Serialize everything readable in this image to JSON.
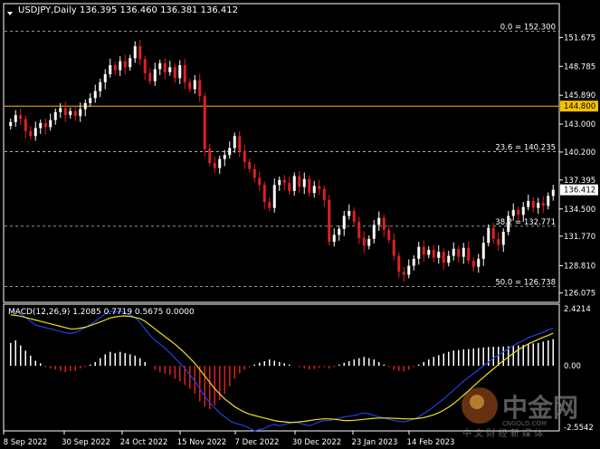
{
  "header": {
    "symbol": "USDJPY,Daily",
    "ohlc": "136.395 136.460 136.381 136.412"
  },
  "chart_data": [
    {
      "type": "candlestick",
      "ylim": [
        125.5,
        153.8
      ],
      "price_ticks": [
        "151.675",
        "148.785",
        "145.890",
        "143.000",
        "140.200",
        "137.395",
        "134.500",
        "131.770",
        "128.810",
        "126.075"
      ],
      "price_tick_values": [
        151.675,
        148.785,
        145.89,
        143.0,
        140.2,
        137.395,
        134.5,
        131.77,
        128.81,
        126.075
      ],
      "current_price": {
        "label": "136.412",
        "value": 136.412
      },
      "horizontal_line": {
        "label": "144.800",
        "value": 144.8,
        "color": "#f5c000"
      },
      "fibonacci": [
        {
          "label": "0.0 = 152.300",
          "value": 152.3
        },
        {
          "label": "23.6 = 140.235",
          "value": 140.235
        },
        {
          "label": "38.2 = 132.771",
          "value": 132.771
        },
        {
          "label": "50.0 = 126.738",
          "value": 126.738
        }
      ],
      "close": [
        143.2,
        143.9,
        143.5,
        142.3,
        141.8,
        142.6,
        143.1,
        142.7,
        143.4,
        144.2,
        144.6,
        143.9,
        144.3,
        143.8,
        144.5,
        145.1,
        145.6,
        146.3,
        147.2,
        148.0,
        148.9,
        148.4,
        149.3,
        148.7,
        149.6,
        150.8,
        149.5,
        148.1,
        147.3,
        148.5,
        149.1,
        148.2,
        148.7,
        147.6,
        148.9,
        147.2,
        146.5,
        147.4,
        145.8,
        140.5,
        139.1,
        138.6,
        139.5,
        139.9,
        140.6,
        141.8,
        140.3,
        139.2,
        138.5,
        137.6,
        136.9,
        135.2,
        134.6,
        136.9,
        137.4,
        137.1,
        136.3,
        137.8,
        136.7,
        137.5,
        136.1,
        136.8,
        136.5,
        135.4,
        131.2,
        131.9,
        132.5,
        133.8,
        134.3,
        133.2,
        131.6,
        130.8,
        131.5,
        132.9,
        133.6,
        132.4,
        131.4,
        129.8,
        128.2,
        127.9,
        128.8,
        129.5,
        130.7,
        129.9,
        130.4,
        129.6,
        130.2,
        129.1,
        129.8,
        130.5,
        129.7,
        130.6,
        129.3,
        128.7,
        129.5,
        131.1,
        132.6,
        131.5,
        130.9,
        132.2,
        133.8,
        134.4,
        133.9,
        134.7,
        135.3,
        134.6,
        135.1,
        134.8,
        135.8,
        136.412
      ],
      "macd": {
        "label": "MACD(12,26,9) 1.2085 0.7719 0.5675 0.0000",
        "ylim": [
          -2.5542,
          2.4214
        ],
        "ticks": [
          "2.4214",
          "0.00",
          "-2.5542"
        ],
        "hist": [
          0.9,
          1.0,
          0.8,
          0.6,
          0.4,
          0.2,
          0.1,
          -0.05,
          -0.1,
          -0.15,
          -0.2,
          -0.25,
          -0.2,
          -0.2,
          -0.1,
          -0.05,
          0.05,
          0.15,
          0.3,
          0.45,
          0.55,
          0.5,
          0.55,
          0.5,
          0.45,
          0.4,
          0.3,
          0.15,
          0.0,
          -0.15,
          -0.25,
          -0.3,
          -0.35,
          -0.5,
          -0.6,
          -0.75,
          -0.9,
          -1.1,
          -1.4,
          -1.6,
          -1.7,
          -1.55,
          -1.35,
          -1.1,
          -0.8,
          -0.5,
          -0.3,
          -0.15,
          -0.05,
          0.05,
          0.12,
          0.18,
          0.25,
          0.2,
          0.15,
          0.1,
          0.05,
          0.0,
          -0.05,
          -0.1,
          -0.15,
          -0.12,
          -0.08,
          -0.05,
          -0.1,
          -0.05,
          0.05,
          0.12,
          0.18,
          0.25,
          0.3,
          0.35,
          0.3,
          0.25,
          0.15,
          0.05,
          -0.05,
          -0.15,
          -0.2,
          -0.22,
          -0.15,
          -0.05,
          0.05,
          0.15,
          0.25,
          0.35,
          0.42,
          0.48,
          0.55,
          0.6,
          0.62,
          0.65,
          0.66,
          0.68,
          0.7,
          0.72,
          0.74,
          0.75,
          0.75,
          0.76,
          0.77,
          0.78,
          0.8,
          0.82,
          0.85,
          0.88,
          0.9,
          0.95,
          1.0,
          1.05
        ],
        "signal": [
          2.0,
          1.98,
          1.95,
          1.9,
          1.85,
          1.8,
          1.75,
          1.7,
          1.65,
          1.6,
          1.55,
          1.5,
          1.45,
          1.45,
          1.48,
          1.52,
          1.58,
          1.65,
          1.72,
          1.8,
          1.88,
          1.92,
          1.95,
          1.96,
          1.94,
          1.9,
          1.85,
          1.75,
          1.6,
          1.45,
          1.3,
          1.15,
          1.0,
          0.85,
          0.68,
          0.5,
          0.3,
          0.1,
          -0.15,
          -0.4,
          -0.65,
          -0.9,
          -1.1,
          -1.3,
          -1.45,
          -1.6,
          -1.72,
          -1.82,
          -1.9,
          -1.95,
          -2.0,
          -2.05,
          -2.1,
          -2.15,
          -2.18,
          -2.2,
          -2.22,
          -2.22,
          -2.2,
          -2.18,
          -2.15,
          -2.12,
          -2.1,
          -2.08,
          -2.08,
          -2.1,
          -2.12,
          -2.15,
          -2.15,
          -2.14,
          -2.12,
          -2.1,
          -2.08,
          -2.06,
          -2.05,
          -2.05,
          -2.05,
          -2.06,
          -2.07,
          -2.08,
          -2.08,
          -2.08,
          -2.06,
          -2.03,
          -1.98,
          -1.92,
          -1.84,
          -1.74,
          -1.62,
          -1.48,
          -1.32,
          -1.15,
          -0.98,
          -0.8,
          -0.62,
          -0.45,
          -0.28,
          -0.12,
          0.05,
          0.2,
          0.35,
          0.5,
          0.63,
          0.75,
          0.86,
          0.95,
          1.04,
          1.12,
          1.2,
          1.28
        ],
        "macd_line": [
          2.1,
          2.15,
          2.05,
          1.9,
          1.75,
          1.6,
          1.55,
          1.5,
          1.45,
          1.4,
          1.35,
          1.3,
          1.28,
          1.3,
          1.4,
          1.5,
          1.62,
          1.75,
          1.9,
          2.05,
          2.15,
          2.1,
          2.15,
          2.08,
          2.0,
          1.9,
          1.7,
          1.45,
          1.2,
          1.0,
          0.85,
          0.7,
          0.5,
          0.3,
          0.1,
          -0.1,
          -0.35,
          -0.6,
          -0.9,
          -1.2,
          -1.45,
          -1.65,
          -1.85,
          -2.0,
          -2.15,
          -2.25,
          -2.3,
          -2.35,
          -2.45,
          -2.55,
          -2.5,
          -2.45,
          -2.35,
          -2.3,
          -2.35,
          -2.3,
          -2.25,
          -2.2,
          -2.25,
          -2.3,
          -2.35,
          -2.28,
          -2.2,
          -2.15,
          -2.15,
          -2.1,
          -2.05,
          -2.0,
          -1.98,
          -1.95,
          -1.9,
          -1.85,
          -1.88,
          -1.95,
          -2.0,
          -2.05,
          -2.1,
          -2.15,
          -2.18,
          -2.2,
          -2.15,
          -2.1,
          -2.0,
          -1.88,
          -1.75,
          -1.6,
          -1.45,
          -1.3,
          -1.12,
          -0.95,
          -0.78,
          -0.6,
          -0.45,
          -0.3,
          -0.15,
          0.0,
          0.15,
          0.3,
          0.42,
          0.55,
          0.68,
          0.8,
          0.9,
          1.0,
          1.1,
          1.18,
          1.25,
          1.32,
          1.4,
          1.48
        ]
      },
      "x_labels": [
        "8 Sep 2022",
        "30 Sep 2022",
        "24 Oct 2022",
        "15 Nov 2022",
        "7 Dec 2022",
        "30 Dec 2022",
        "23 Jan 2023",
        "14 Feb 2023"
      ]
    }
  ],
  "colors": {
    "background": "#000000",
    "bull": "#ffffff",
    "bear": "#e02020",
    "grid": "#c8c8c8",
    "macd_line": "#2040e0",
    "signal_line": "#f0e020",
    "hist_pos": "#ffffff",
    "hist_neg": "#e02020"
  },
  "watermark": {
    "brand": "中金网",
    "site": "CNGOLD.COM",
    "slogan": "中 文 财 经 新 媒 体"
  }
}
